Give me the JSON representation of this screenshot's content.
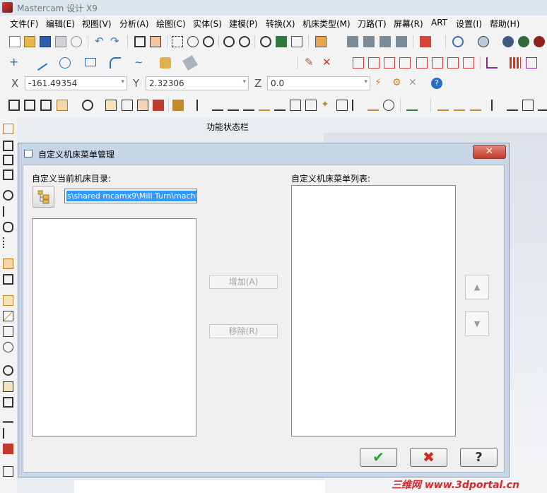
{
  "app": {
    "title": "Mastercam 设计 X9"
  },
  "menu": [
    "文件(F)",
    "编辑(E)",
    "视图(V)",
    "分析(A)",
    "绘图(C)",
    "实体(S)",
    "建模(P)",
    "转换(X)",
    "机床类型(M)",
    "刀路(T)",
    "屏幕(R)",
    "ART",
    "设置(I)",
    "帮助(H)"
  ],
  "coords": {
    "x_label": "X",
    "x_value": "-161.49354",
    "y_label": "Y",
    "y_value": "2.32306",
    "z_label": "Z",
    "z_value": "0.0"
  },
  "status_bar_label": "功能状态栏",
  "dialog": {
    "title": "自定义机床菜单管理",
    "close_glyph": "✕",
    "current_dir_label": "自定义当前机床目录:",
    "path_value": "s\\shared mcamx9\\Mill Turn\\machines\\",
    "list_label": "自定义机床菜单列表:",
    "add_button": "增加(A)",
    "remove_button": "移除(R)",
    "up_glyph": "▲",
    "down_glyph": "▼",
    "ok_glyph": "✔",
    "cancel_glyph": "✖",
    "help_glyph": "?"
  },
  "watermark": "三维网 www.3dportal.cn",
  "colors": {
    "accent_selection": "#3399ff",
    "close_red": "#c23b2c",
    "ok_green": "#2aa32a",
    "cancel_red": "#d22a1f"
  }
}
